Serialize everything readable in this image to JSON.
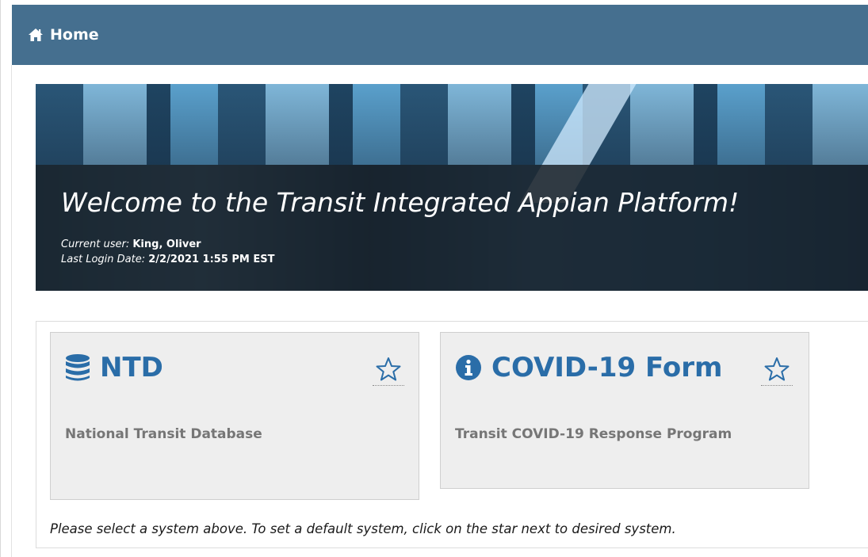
{
  "header": {
    "title": "Home",
    "icon": "home-icon",
    "background": "#456f8f"
  },
  "banner": {
    "welcome": "Welcome to the Transit Integrated Appian Platform!",
    "current_user_label": "Current user:",
    "current_user_value": "King, Oliver",
    "last_login_label": "Last Login Date:",
    "last_login_value": "2/2/2021 1:55 PM EST"
  },
  "systems": [
    {
      "name": "NTD",
      "icon": "database-icon",
      "description": "National Transit Database",
      "favorite_icon": "star-outline-icon"
    },
    {
      "name": "COVID-19 Form",
      "icon": "info-circle-icon",
      "description": "Transit COVID-19 Response Program",
      "favorite_icon": "star-outline-icon"
    }
  ],
  "instructions": "Please select a system above. To set a default system, click on the star next to desired system.",
  "colors": {
    "accent": "#2a6da8",
    "card_bg": "#eeeeee",
    "subtitle": "#767676"
  }
}
